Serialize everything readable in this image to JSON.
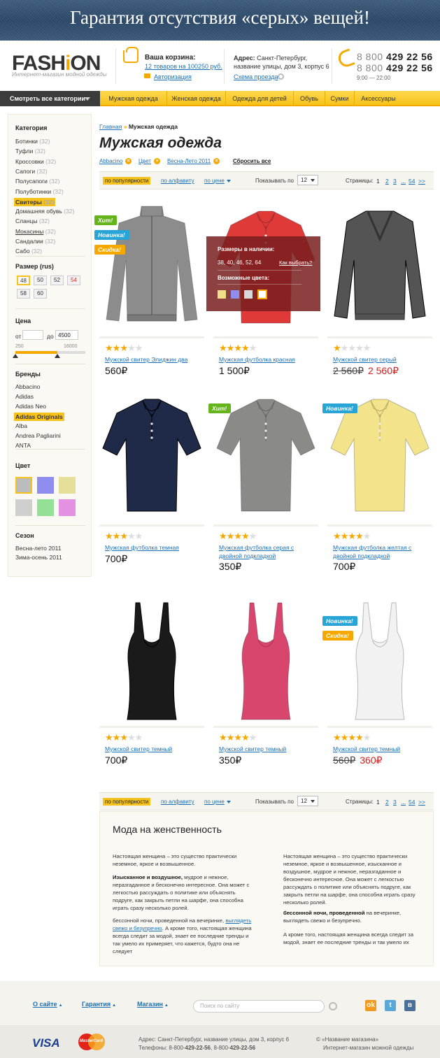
{
  "banner": {
    "text": "Гарантия отсутствия «серых» вещей!"
  },
  "header": {
    "logo_pre": "FASH",
    "logo_accent": "i",
    "logo_post": "ON",
    "logo_sub": "Интернет-магазин модной одежды",
    "cart_title": "Ваша корзина:",
    "cart_link": "12 товаров на 100250 руб.",
    "auth_link": "Авторизация",
    "address_label": "Адрес:",
    "address_line1": "Санкт-Петербург,",
    "address_line2": "название улицы, дом 3, корпус 6",
    "route_link": "Схема проезда",
    "phone1_prefix": "8 800",
    "phone1_main": "429 22 56",
    "phone2_prefix": "8 800",
    "phone2_main": "429 22 56",
    "hours": "9:00 — 22:00"
  },
  "nav": {
    "all_categories": "Смотреть все категории",
    "items": [
      {
        "label": "Мужская одежда",
        "active": true
      },
      {
        "label": "Женская одежда",
        "active": false
      },
      {
        "label": "Одежда для детей",
        "active": false
      },
      {
        "label": "Обувь",
        "active": true
      },
      {
        "label": "Сумки",
        "active": false
      },
      {
        "label": "Аксессуары",
        "active": false
      }
    ]
  },
  "sidebar": {
    "category_title": "Категория",
    "categories": [
      {
        "label": "Ботинки",
        "count": "(32)",
        "selected": false,
        "link": false
      },
      {
        "label": "Туфли",
        "count": "(32)",
        "selected": false,
        "link": false
      },
      {
        "label": "Кроссовки",
        "count": "(32)",
        "selected": false,
        "link": false
      },
      {
        "label": "Сапоги",
        "count": "(32)",
        "selected": false,
        "link": false
      },
      {
        "label": "Полусапоги",
        "count": "(32)",
        "selected": false,
        "link": false
      },
      {
        "label": "Полуботинки",
        "count": "(32)",
        "selected": false,
        "link": false
      },
      {
        "label": "Свитеры",
        "count": "(32)",
        "selected": true,
        "link": false
      },
      {
        "label": "Домашняя обувь",
        "count": "(32)",
        "selected": false,
        "link": false
      },
      {
        "label": "Сланцы",
        "count": "(32)",
        "selected": false,
        "link": false
      },
      {
        "label": "Мокасины",
        "count": "(32)",
        "selected": false,
        "link": true
      },
      {
        "label": "Сандалии",
        "count": "(32)",
        "selected": false,
        "link": false
      },
      {
        "label": "Сабо",
        "count": "(32)",
        "selected": false,
        "link": false
      }
    ],
    "size_title": "Размер (rus)",
    "sizes": [
      "48",
      "50",
      "52",
      "54",
      "58",
      "60"
    ],
    "price_title": "Цена",
    "price_from_label": "от",
    "price_from_value": "",
    "price_to_label": "до",
    "price_to_value": "4500",
    "price_min": "250",
    "price_max": "16000",
    "price_range_fraction": [
      0.0,
      0.6
    ],
    "brands_title": "Бренды",
    "brands": [
      {
        "label": "Abbacino",
        "selected": false
      },
      {
        "label": "Adidas",
        "selected": false
      },
      {
        "label": "Adidas Neo",
        "selected": false
      },
      {
        "label": "Adidas Originals",
        "selected": true
      },
      {
        "label": "Alba",
        "selected": false
      },
      {
        "label": "Andrea Pagliarini",
        "selected": false
      },
      {
        "label": "ANTA",
        "selected": false
      }
    ],
    "color_title": "Цвет",
    "colors": [
      "#bcbcbc",
      "#8f8ef0",
      "#e6df9a",
      "#cfcfcf",
      "#93e096",
      "#e391e0"
    ],
    "season_title": "Сезон",
    "seasons": [
      "Весна-лето 2011",
      "Зима-осень 2011"
    ]
  },
  "main": {
    "breadcrumb_home": "Главная",
    "breadcrumb_current": "Мужская одежда",
    "title": "Мужская одежда",
    "filters": [
      "Abbacino",
      "Цвет",
      "Весна-Лето 2011"
    ],
    "reset_label": "Сбросить все",
    "sort": {
      "popular": "по популярности",
      "alphabet": "по алфавиту",
      "price": "по цене",
      "show_label": "Показывать по",
      "show_value": "12",
      "pages_label": "Страницы:",
      "pages": [
        "1",
        "2",
        "3",
        "...",
        "54",
        ">>"
      ]
    }
  },
  "popup": {
    "sizes_title": "Размеры в наличии:",
    "sizes_value": "38, 40, 46, 52, 64",
    "how_to_choose": "Как выбрать?",
    "colors_title": "Возможные цвета:",
    "colors": [
      "#f0e08a",
      "#8f8ef0",
      "#d8d8d8",
      "#ffffff"
    ]
  },
  "products": [
    {
      "name": "Мужской свитер Элиджин два",
      "rating": 3,
      "price": "560₽",
      "old_price": "",
      "new_price": "",
      "badges": [
        {
          "text": "Хит!",
          "type": "hit"
        },
        {
          "text": "Новинка!",
          "type": "new"
        },
        {
          "text": "Скидка!",
          "type": "sale"
        }
      ],
      "kind": "zip-sweater",
      "color": "#8c8c8c"
    },
    {
      "name": "Мужская футболка красная",
      "rating": 4,
      "price": "1 500₽",
      "old_price": "",
      "new_price": "",
      "badges": [],
      "kind": "polo",
      "color": "#e03a38"
    },
    {
      "name": "Мужской свитер серый",
      "rating": 1,
      "price": "",
      "old_price": "2 560₽",
      "new_price": "2 560₽",
      "badges": [],
      "kind": "v-sweater",
      "color": "#545454"
    },
    {
      "name": "Мужская футболка темная",
      "rating": 3,
      "price": "700₽",
      "old_price": "",
      "new_price": "",
      "badges": [],
      "kind": "polo",
      "color": "#1e2a48"
    },
    {
      "name": "Мужская футболка серая с двойной подкладкой",
      "rating": 4,
      "price": "350₽",
      "old_price": "",
      "new_price": "",
      "badges": [
        {
          "text": "Хит!",
          "type": "hit"
        }
      ],
      "kind": "polo",
      "color": "#8a8a86"
    },
    {
      "name": "Мужская футболка желтая с двойной подкладкой",
      "rating": 4,
      "price": "700₽",
      "old_price": "",
      "new_price": "",
      "badges": [
        {
          "text": "Новинка!",
          "type": "new"
        }
      ],
      "kind": "polo",
      "color": "#f3e48c"
    },
    {
      "name": "Мужской свитер темный",
      "rating": 3,
      "price": "700₽",
      "old_price": "",
      "new_price": "",
      "badges": [],
      "kind": "tank",
      "color": "#1a1a1a"
    },
    {
      "name": "Мужской свитер темный",
      "rating": 4,
      "price": "350₽",
      "old_price": "",
      "new_price": "",
      "badges": [],
      "kind": "tank",
      "color": "#d8466e"
    },
    {
      "name": "Мужской свитер темный",
      "rating": 4,
      "price": "",
      "old_price": "560₽",
      "new_price": "360₽",
      "badges": [
        {
          "text": "Новинка!",
          "type": "new"
        },
        {
          "text": "Скидка!",
          "type": "sale"
        }
      ],
      "kind": "tank",
      "color": "#f2f2f2"
    }
  ],
  "article": {
    "title": "Мода на женственность",
    "col1_p1": "Настоящая женщина – это существо практически неземное, яркое и возвышенное.",
    "col1_p2_bold": "Изысканное и воздушное,",
    "col1_p2": " мудрое и нежное, неразгаданное и бесконечно интересное. Она может с легкостью рассуждать о политике или объяснять подруге, как закрыть петли на шарфе, она способна играть сразу несколько ролей.",
    "col1_p3": "бессонной ночи, проведенной на вечеринке, ",
    "col1_p3_link": "выглядеть свежо и безупречно",
    "col1_p3_end": ". А кроме того, настоящая женщина всегда следит за модой, знает ее последние тренды и так умело их примеряет, что кажется, будто она не следует",
    "col2_p1": "Настоящая женщина – это существо практически неземное, яркое и возвышенное, изысканное и воздушное, мудрое и нежное, неразгаданное и бесконечно интересное. Она может с легкостью рассуждать о политике или объяснять подруге, как закрыть петли на шарфе, она способна играть сразу несколько ролей.",
    "col2_p2_bold": "бессонной ночи, проведенной",
    "col2_p2": " на вечеринке, выглядеть свежо и безупречно.",
    "col2_p3": "А кроме того, настоящая женщина всегда следит за модой, знает ее последние тренды и так умело их"
  },
  "footer": {
    "nav": [
      "О сайте",
      "Гарантия",
      "Магазин"
    ],
    "search_placeholder": "Поиск по сайту",
    "social": [
      "ok",
      "t",
      "в"
    ],
    "visa": "VISA",
    "mastercard": "MasterCard",
    "address": "Адрес: Санкт-Петербург, название улицы, дом 3, корпус 6",
    "phones_label": "Телефоны: ",
    "phone1_prefix": "8-800-",
    "phone1_main": "429-22-56",
    "phone2_prefix": "8-800-",
    "phone2_main": "429-22-56",
    "copyright": "© «Название магазина»",
    "copyright_sub": "Интернет-магазин можной одежды"
  }
}
